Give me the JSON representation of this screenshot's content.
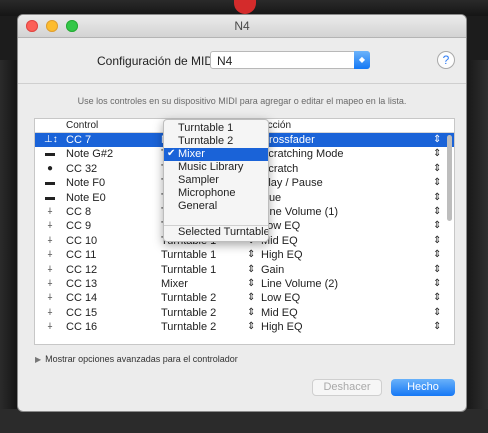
{
  "window": {
    "title": "N4"
  },
  "config": {
    "label": "Configuración de MIDI:",
    "device": "N4",
    "help": "?"
  },
  "instructions": "Use los controles en su dispositivo MIDI para agregar o editar el mapeo en la lista.",
  "table": {
    "headers": {
      "control": "Control",
      "action": "Acción"
    },
    "rows": [
      {
        "icon": "knob-fader-icon",
        "glyph": "⊥↕",
        "control": "CC 7",
        "target": "Mixer",
        "action": "Crossfader",
        "selected": true
      },
      {
        "icon": "button-icon",
        "glyph": "▬",
        "control": "Note G#2",
        "target": "Turntable 1",
        "action": "Scratching Mode",
        "selected": false
      },
      {
        "icon": "knob-icon",
        "glyph": "●",
        "control": "CC 32",
        "target": "Turntable 1",
        "action": "Scratch",
        "selected": false
      },
      {
        "icon": "button-icon",
        "glyph": "▬",
        "control": "Note F0",
        "target": "Turntable 1",
        "action": "Play / Pause",
        "selected": false
      },
      {
        "icon": "button-icon",
        "glyph": "▬",
        "control": "Note E0",
        "target": "Turntable 1",
        "action": "Cue",
        "selected": false
      },
      {
        "icon": "fader-icon",
        "glyph": "⍭",
        "control": "CC 8",
        "target": "Turntable 1",
        "action": "Line Volume (1)",
        "selected": false
      },
      {
        "icon": "fader-icon",
        "glyph": "⍭",
        "control": "CC 9",
        "target": "Turntable 1",
        "action": "Low EQ",
        "selected": false
      },
      {
        "icon": "fader-icon",
        "glyph": "⍭",
        "control": "CC 10",
        "target": "Turntable 1",
        "action": "Mid EQ",
        "selected": false
      },
      {
        "icon": "fader-icon",
        "glyph": "⍭",
        "control": "CC 11",
        "target": "Turntable 1",
        "action": "High EQ",
        "selected": false
      },
      {
        "icon": "fader-icon",
        "glyph": "⍭",
        "control": "CC 12",
        "target": "Turntable 1",
        "action": "Gain",
        "selected": false
      },
      {
        "icon": "fader-icon",
        "glyph": "⍭",
        "control": "CC 13",
        "target": "Mixer",
        "action": "Line Volume (2)",
        "selected": false
      },
      {
        "icon": "fader-icon",
        "glyph": "⍭",
        "control": "CC 14",
        "target": "Turntable 2",
        "action": "Low EQ",
        "selected": false
      },
      {
        "icon": "fader-icon",
        "glyph": "⍭",
        "control": "CC 15",
        "target": "Turntable 2",
        "action": "Mid EQ",
        "selected": false
      },
      {
        "icon": "fader-icon",
        "glyph": "⍭",
        "control": "CC 16",
        "target": "Turntable 2",
        "action": "High EQ",
        "selected": false
      }
    ]
  },
  "dropdown": {
    "items": [
      {
        "label": "Turntable 1",
        "checked": false
      },
      {
        "label": "Turntable 2",
        "checked": false
      },
      {
        "label": "Mixer",
        "checked": true
      },
      {
        "label": "Music Library",
        "checked": false
      },
      {
        "label": "Sampler",
        "checked": false
      },
      {
        "label": "Microphone",
        "checked": false
      },
      {
        "label": "General",
        "checked": false
      },
      {
        "label": "Selected Turntable",
        "checked": false
      }
    ]
  },
  "advanced": {
    "label": "Mostrar opciones avanzadas para el controlador"
  },
  "buttons": {
    "undo": "Deshacer",
    "done": "Hecho"
  },
  "colors": {
    "accent": "#1a63d8",
    "close": "#fc5f57",
    "minimize": "#fdbc2e",
    "maximize": "#33c748"
  }
}
